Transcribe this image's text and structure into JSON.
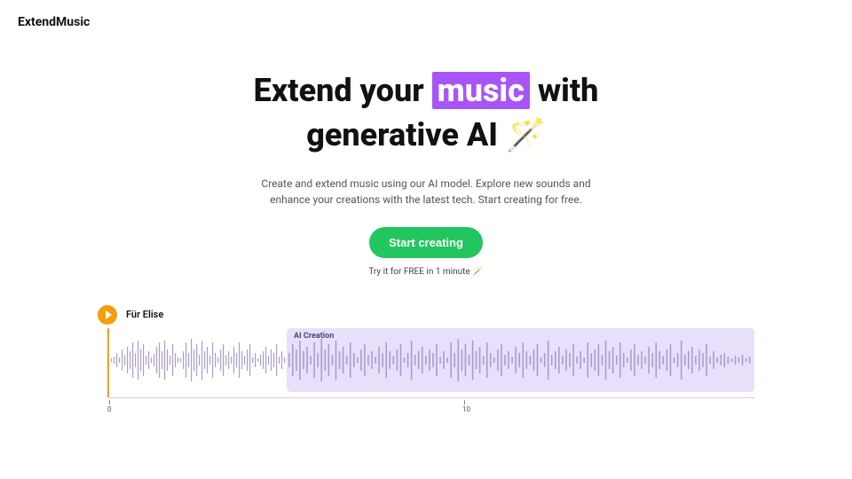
{
  "header": {
    "logo": "ExtendMusic"
  },
  "hero": {
    "title_pre": "Extend your ",
    "title_highlight": "music",
    "title_mid": " with generative AI ",
    "title_emoji": "🪄",
    "subtitle": "Create and extend music using our AI model. Explore new sounds and enhance your creations with the latest tech. Start creating for free.",
    "cta_label": "Start creating",
    "cta_sub": "Try it for FREE in 1 minute 🪄"
  },
  "track": {
    "name": "Für Elise",
    "extension_label": "AI Creation",
    "timeline": {
      "tick0": "0",
      "tick10": "10"
    }
  },
  "colors": {
    "accent_purple": "#a855f7",
    "cta_green": "#22c55e",
    "play_orange": "#f59e0b",
    "wave_bg": "#e9dffb"
  }
}
